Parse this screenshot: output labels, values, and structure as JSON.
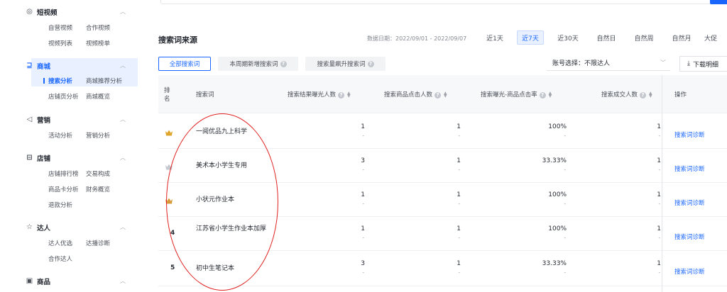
{
  "sidebar": {
    "sections": [
      {
        "icon": "play-circle-icon",
        "label": "短视频",
        "items": [
          [
            "自营视频",
            "合作视频"
          ],
          [
            "视频列表",
            "视频榜单"
          ]
        ]
      },
      {
        "icon": "shopping-cart-icon",
        "label": "商城",
        "items": [
          [
            "搜索分析",
            "商城推荐分析"
          ],
          [
            "店铺页分析",
            "商城概览"
          ]
        ]
      },
      {
        "icon": "megaphone-icon",
        "label": "营销",
        "items": [
          [
            "活动分析",
            "营销分析"
          ]
        ]
      },
      {
        "icon": "store-icon",
        "label": "店铺",
        "items": [
          [
            "店铺排行榜",
            "交易构成"
          ],
          [
            "商品卡分析",
            "财务概览"
          ],
          [
            "退款分析"
          ]
        ]
      },
      {
        "icon": "star-user-icon",
        "label": "达人",
        "items": [
          [
            "达人优选",
            "达播诊断"
          ],
          [
            "合作达人"
          ]
        ]
      },
      {
        "icon": "box-icon",
        "label": "商品",
        "items": []
      }
    ]
  },
  "main": {
    "title": "搜索词来源",
    "date_label": "数据日期：2022/09/01 - 2022/09/07",
    "ranges": [
      "近1天",
      "近7天",
      "近30天",
      "自然日",
      "自然周",
      "自然月",
      "大促"
    ],
    "active_range": "近7天",
    "tabs": [
      "全部搜索词",
      "本周期新增搜索词",
      "搜索量飙升搜索词"
    ],
    "account_label": "账号选择：不限达人",
    "download_label": "下载明细",
    "table": {
      "headers": {
        "rank": "排名",
        "keyword": "搜索词",
        "exposure": "搜索结果曝光人数",
        "clicks": "搜索商品点击人数",
        "ctr": "搜索曝光-商品点击率",
        "deals": "搜索成交人数",
        "op": "操作"
      },
      "rows": [
        {
          "rank": "",
          "medal": "gold",
          "keyword": "一阅优品九上科学",
          "exposure": "1",
          "clicks": "1",
          "ctr": "100%",
          "deals": "1",
          "sub": "-",
          "op": "搜索词诊断"
        },
        {
          "rank": "",
          "medal": "silver",
          "keyword": "美术本小学生专用",
          "exposure": "3",
          "clicks": "1",
          "ctr": "33.33%",
          "deals": "1",
          "sub": "-",
          "op": "搜索词诊断"
        },
        {
          "rank": "",
          "medal": "bronze",
          "keyword": "小状元作业本",
          "exposure": "1",
          "clicks": "1",
          "ctr": "100%",
          "deals": "1",
          "sub": "-",
          "op": "搜索词诊断"
        },
        {
          "rank": "4",
          "medal": "",
          "keyword": "江苏省小学生作业本加厚",
          "exposure": "1",
          "clicks": "1",
          "ctr": "100%",
          "deals": "1",
          "sub": "-",
          "op": "搜索词诊断"
        },
        {
          "rank": "5",
          "medal": "",
          "keyword": "初中生笔记本",
          "exposure": "3",
          "clicks": "1",
          "ctr": "33.33%",
          "deals": "1",
          "sub": "-",
          "op": "搜索词诊断"
        }
      ]
    }
  },
  "colors": {
    "accent": "#1966ff",
    "annotation": "#e02020",
    "gold": "#e0a52c",
    "silver": "#c5c9d0"
  }
}
